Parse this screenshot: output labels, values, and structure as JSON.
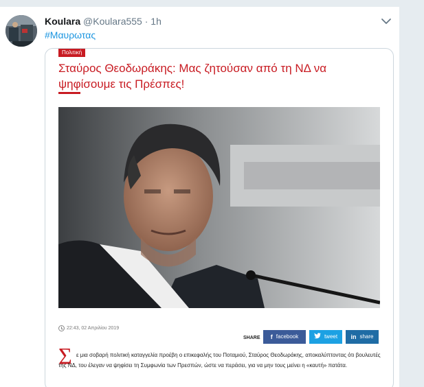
{
  "tweet": {
    "display_name": "Koulara",
    "handle": "@Koulara555",
    "separator": "·",
    "time": "1h",
    "hashtag": "#Μαυρωτας"
  },
  "card": {
    "category": "Πολιτική",
    "title": "Σταύρος Θεοδωράκης: Μας ζητούσαν από τη ΝΔ να ψηφίσουμε τις Πρέσπες!",
    "date": "22:43, 02 Απριλίου 2019",
    "share_label": "SHARE",
    "share_buttons": [
      {
        "icon": "f",
        "label": "facebook"
      },
      {
        "icon": "twitter-bird-icon",
        "label": "tweet"
      },
      {
        "icon": "in",
        "label": "share"
      }
    ],
    "dropcap": "Σ",
    "body": "ε μια σοβαρή πολιτική καταγγελία προέβη ο επικεφαλής του Ποταμιού, Σταύρος Θεοδωράκης, αποκαλύπτοντας ότι βουλευτές της ΝΔ, του έλεγαν να ψηφίσει τη Συμφωνία των Πρεσπών, ώστε να περάσει, για να μην τους μείνει η «καυτή» πατάτα."
  },
  "colors": {
    "brand_red": "#c81b22",
    "facebook": "#3b5b99",
    "twitter": "#1ca1e3",
    "linkedin": "#1f6ca5",
    "link_blue": "#1b95e0"
  }
}
